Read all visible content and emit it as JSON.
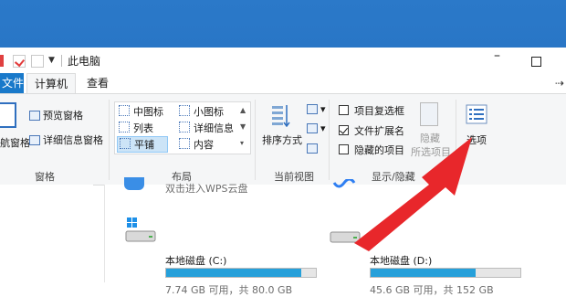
{
  "window": {
    "title": "此电脑"
  },
  "tabs": {
    "file": "文件",
    "computer": "计算机",
    "view": "查看"
  },
  "ribbon": {
    "panes": {
      "preview": "预览窗格",
      "details": "详细信息窗格",
      "nav_partial": "航窗格"
    },
    "layout": {
      "medium_icons": "中图标",
      "small_icons": "小图标",
      "list": "列表",
      "details": "详细信息",
      "tiles": "平铺",
      "content": "内容"
    },
    "sort_by": "排序方式",
    "show_hide": {
      "item_checkboxes": "项目复选框",
      "item_checkboxes_checked": false,
      "file_extensions": "文件扩展名",
      "file_extensions_checked": true,
      "hidden_items": "隐藏的项目",
      "hidden_items_checked": false,
      "hide_selected_line1": "隐藏",
      "hide_selected_line2": "所选项目"
    },
    "options": "选项",
    "groups": {
      "panes": "窗格",
      "layout": "布局",
      "current_view": "当前视图",
      "show_hide": "显示/隐藏"
    }
  },
  "content": {
    "wps_label": "双击进入WPS云盘",
    "drives": [
      {
        "name": "本地磁盘 (C:)",
        "free_text": "7.74 GB 可用，共 80.0 GB",
        "used_fraction": 0.903
      },
      {
        "name": "本地磁盘 (D:)",
        "free_text": "45.6 GB 可用，共 152 GB",
        "used_fraction": 0.7
      }
    ]
  },
  "colors": {
    "accent": "#1979ca",
    "drive_bar": "#26a0da",
    "arrow": "#e8272b",
    "desktop": "#2b79c9"
  }
}
